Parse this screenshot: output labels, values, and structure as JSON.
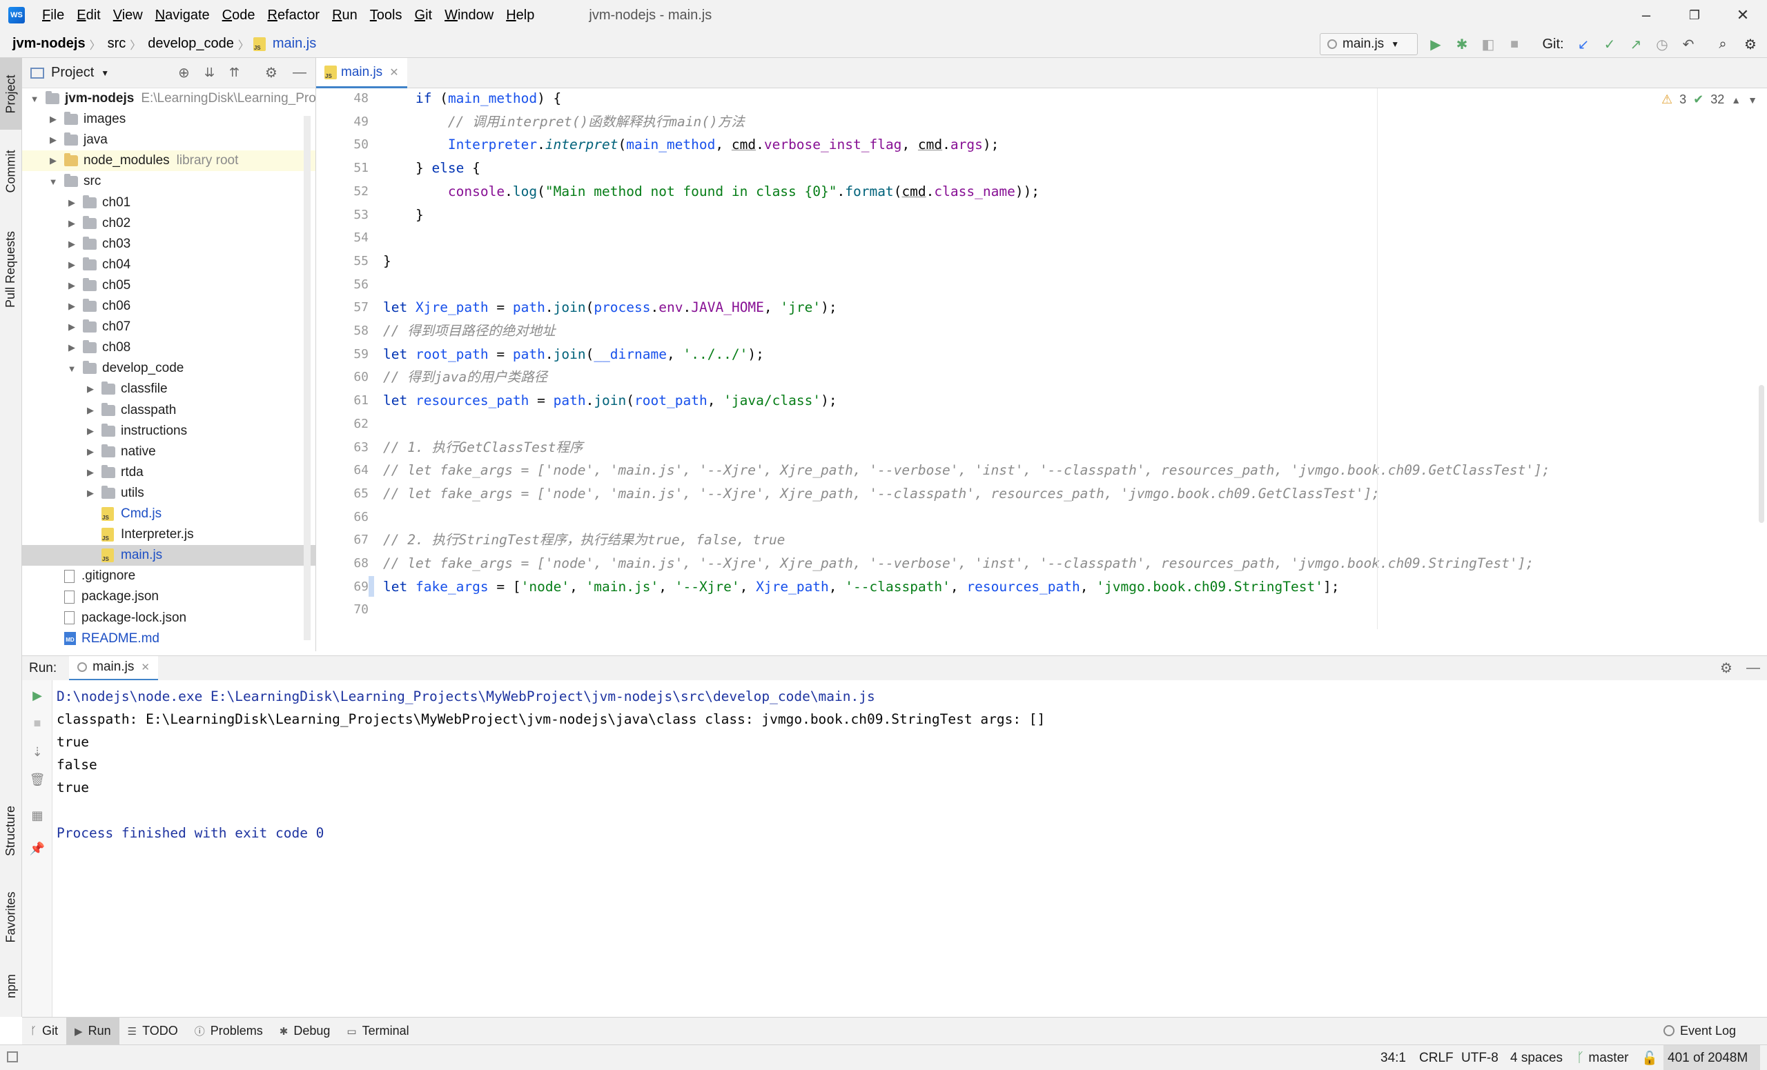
{
  "window": {
    "logo_text": "WS",
    "title": "jvm-nodejs - main.js",
    "menu": [
      "File",
      "Edit",
      "View",
      "Navigate",
      "Code",
      "Refactor",
      "Run",
      "Tools",
      "Git",
      "Window",
      "Help"
    ],
    "minimize_icon": "–",
    "restore_icon": "❐",
    "close_icon": "✕"
  },
  "nav": {
    "breadcrumbs": [
      "jvm-nodejs",
      "src",
      "develop_code",
      "main.js"
    ],
    "run_config": "main.js",
    "git_label": "Git:"
  },
  "left_strip": {
    "tabs": [
      "Project",
      "Commit",
      "Pull Requests",
      "Structure",
      "Favorites",
      "npm"
    ]
  },
  "project": {
    "header": "Project",
    "tree": [
      {
        "label": "jvm-nodejs",
        "hint": "E:\\LearningDisk\\Learning_Pro",
        "kind": "root",
        "depth": 0,
        "expanded": true
      },
      {
        "label": "images",
        "kind": "folder",
        "depth": 1
      },
      {
        "label": "java",
        "kind": "folder",
        "depth": 1
      },
      {
        "label": "node_modules",
        "hint": "library root",
        "kind": "lib",
        "depth": 1
      },
      {
        "label": "src",
        "kind": "folder",
        "depth": 1,
        "expanded": true
      },
      {
        "label": "ch01",
        "kind": "folder",
        "depth": 2
      },
      {
        "label": "ch02",
        "kind": "folder",
        "depth": 2
      },
      {
        "label": "ch03",
        "kind": "folder",
        "depth": 2
      },
      {
        "label": "ch04",
        "kind": "folder",
        "depth": 2
      },
      {
        "label": "ch05",
        "kind": "folder",
        "depth": 2
      },
      {
        "label": "ch06",
        "kind": "folder",
        "depth": 2
      },
      {
        "label": "ch07",
        "kind": "folder",
        "depth": 2
      },
      {
        "label": "ch08",
        "kind": "folder",
        "depth": 2
      },
      {
        "label": "develop_code",
        "kind": "folder",
        "depth": 2,
        "expanded": true
      },
      {
        "label": "classfile",
        "kind": "folder",
        "depth": 3
      },
      {
        "label": "classpath",
        "kind": "folder",
        "depth": 3
      },
      {
        "label": "instructions",
        "kind": "folder",
        "depth": 3
      },
      {
        "label": "native",
        "kind": "folder",
        "depth": 3
      },
      {
        "label": "rtda",
        "kind": "folder",
        "depth": 3
      },
      {
        "label": "utils",
        "kind": "folder",
        "depth": 3
      },
      {
        "label": "Cmd.js",
        "kind": "js",
        "depth": 3,
        "blue": true
      },
      {
        "label": "Interpreter.js",
        "kind": "js",
        "depth": 3
      },
      {
        "label": "main.js",
        "kind": "js",
        "depth": 3,
        "blue": true,
        "selected": true
      },
      {
        "label": ".gitignore",
        "kind": "file",
        "depth": 1
      },
      {
        "label": "package.json",
        "kind": "file",
        "depth": 1
      },
      {
        "label": "package-lock.json",
        "kind": "file",
        "depth": 1
      },
      {
        "label": "README.md",
        "kind": "md",
        "depth": 1,
        "blue": true
      }
    ]
  },
  "editor": {
    "tab": "main.js",
    "warnings": "3",
    "checks": "32",
    "lines": [
      {
        "n": "48",
        "html": "    <span class=\"kw\">if</span> (<span class=\"var\">main_method</span>) {"
      },
      {
        "n": "49",
        "html": "        <span class=\"cmt\">// 调用interpret()函数解释执行main()方法</span>"
      },
      {
        "n": "50",
        "html": "        <span class=\"var\">Interpreter</span>.<span class=\"fn\" style=\"font-style:italic\">interpret</span>(<span class=\"var\">main_method</span>, <span class=\"under\">cmd</span>.<span class=\"prop\">verbose_inst_flag</span>, <span class=\"under\">cmd</span>.<span class=\"prop\">args</span>);"
      },
      {
        "n": "51",
        "html": "    } <span class=\"kw\">else</span> {"
      },
      {
        "n": "52",
        "html": "        <span class=\"prop\">console</span>.<span class=\"fn\">log</span>(<span class=\"str\">\"Main method not found in class {0}\"</span>.<span class=\"fn\">format</span>(<span class=\"under\">cmd</span>.<span class=\"prop\">class_name</span>));"
      },
      {
        "n": "53",
        "html": "    }"
      },
      {
        "n": "54",
        "html": ""
      },
      {
        "n": "55",
        "html": "}"
      },
      {
        "n": "56",
        "html": ""
      },
      {
        "n": "57",
        "html": "<span class=\"kw\">let</span> <span class=\"var\">Xjre_path</span> = <span class=\"var\">path</span>.<span class=\"fn\">join</span>(<span class=\"var\">process</span>.<span class=\"prop\">env</span>.<span class=\"prop\">JAVA_HOME</span>, <span class=\"str\">'jre'</span>);"
      },
      {
        "n": "58",
        "html": "<span class=\"cmt\">// 得到项目路径的绝对地址</span>"
      },
      {
        "n": "59",
        "html": "<span class=\"kw\">let</span> <span class=\"var\">root_path</span> = <span class=\"var\">path</span>.<span class=\"fn\">join</span>(<span class=\"var\">__dirname</span>, <span class=\"str\">'../../'</span>);"
      },
      {
        "n": "60",
        "html": "<span class=\"cmt\">// 得到java的用户类路径</span>"
      },
      {
        "n": "61",
        "html": "<span class=\"kw\">let</span> <span class=\"var\">resources_path</span> = <span class=\"var\">path</span>.<span class=\"fn\">join</span>(<span class=\"var\">root_path</span>, <span class=\"str\">'java/class'</span>);"
      },
      {
        "n": "62",
        "html": ""
      },
      {
        "n": "63",
        "html": "<span class=\"cmt\">// 1. 执行GetClassTest程序</span>"
      },
      {
        "n": "64",
        "html": "<span class=\"cmt\">// let fake_args = ['node', 'main.js', '--Xjre', Xjre_path, '--verbose', 'inst', '--classpath', resources_path, 'jvmgo.book.ch09.GetClassTest'];</span>"
      },
      {
        "n": "65",
        "html": "<span class=\"cmt\">// let fake_args = ['node', 'main.js', '--Xjre', Xjre_path, '--classpath', resources_path, 'jvmgo.book.ch09.GetClassTest'];</span>"
      },
      {
        "n": "66",
        "html": ""
      },
      {
        "n": "67",
        "html": "<span class=\"cmt\">// 2. 执行StringTest程序，执行结果为true, false, true</span>"
      },
      {
        "n": "68",
        "html": "<span class=\"cmt\">// let fake_args = ['node', 'main.js', '--Xjre', Xjre_path, '--verbose', 'inst', '--classpath', resources_path, 'jvmgo.book.ch09.StringTest'];</span>"
      },
      {
        "n": "69",
        "html": "<span class=\"kw\">let</span> <span class=\"var\">fake_args</span> = [<span class=\"str\">'node'</span>, <span class=\"str\">'main.js'</span>, <span class=\"str\">'--Xjre'</span>, <span class=\"var\">Xjre_path</span>, <span class=\"str\">'--classpath'</span>, <span class=\"var\">resources_path</span>, <span class=\"str\">'jvmgo.book.ch09.StringTest'</span>];"
      },
      {
        "n": "70",
        "html": ""
      }
    ]
  },
  "run": {
    "label": "Run:",
    "tab": "main.js",
    "output": [
      {
        "text": "D:\\nodejs\\node.exe E:\\LearningDisk\\Learning_Projects\\MyWebProject\\jvm-nodejs\\src\\develop_code\\main.js",
        "sys": true
      },
      {
        "text": "classpath: E:\\LearningDisk\\Learning_Projects\\MyWebProject\\jvm-nodejs\\java\\class class: jvmgo.book.ch09.StringTest args: []",
        "sys": false
      },
      {
        "text": "true",
        "sys": false
      },
      {
        "text": "false",
        "sys": false
      },
      {
        "text": "true",
        "sys": false
      },
      {
        "text": "",
        "sys": false
      },
      {
        "text": "Process finished with exit code 0",
        "sys": true
      }
    ]
  },
  "tool_tabs": [
    "Git",
    "Run",
    "TODO",
    "Problems",
    "Debug",
    "Terminal"
  ],
  "event_log": "Event Log",
  "status": {
    "position": "34:1",
    "line_sep": "CRLF",
    "encoding": "UTF-8",
    "indent": "4 spaces",
    "branch": "master",
    "memory": "401 of 2048M"
  },
  "colors": {
    "accent": "#4083c9",
    "run_green": "#59a869",
    "keyword": "#0033b3",
    "string": "#067d17",
    "comment": "#8c8c8c"
  }
}
